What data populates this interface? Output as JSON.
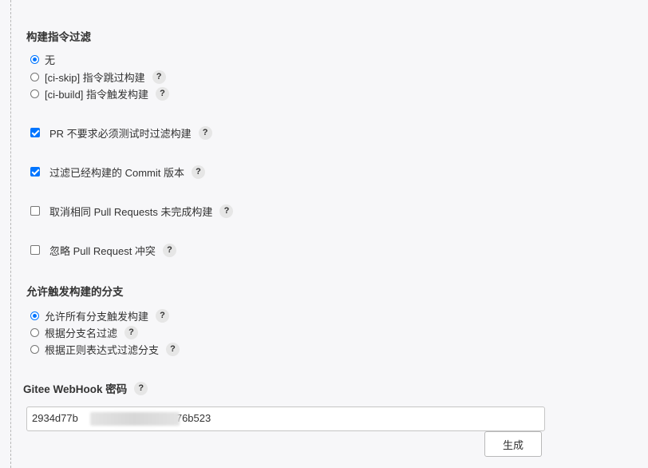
{
  "build_filter": {
    "title": "构建指令过滤",
    "options": [
      {
        "label": "无",
        "checked": true,
        "help": false
      },
      {
        "label": "[ci-skip] 指令跳过构建",
        "checked": false,
        "help": true
      },
      {
        "label": "[ci-build] 指令触发构建",
        "checked": false,
        "help": true
      }
    ]
  },
  "checkboxes": [
    {
      "label": "PR 不要求必须测试时过滤构建",
      "checked": true
    },
    {
      "label": "过滤已经构建的 Commit 版本",
      "checked": true
    },
    {
      "label": "取消相同 Pull Requests 未完成构建",
      "checked": false
    },
    {
      "label": "忽略 Pull Request 冲突",
      "checked": false
    }
  ],
  "branch_filter": {
    "title": "允许触发构建的分支",
    "options": [
      {
        "label": "允许所有分支触发构建",
        "checked": true
      },
      {
        "label": "根据分支名过滤",
        "checked": false
      },
      {
        "label": "根据正则表达式过滤分支",
        "checked": false
      }
    ]
  },
  "webhook": {
    "title": "Gitee WebHook 密码",
    "value_visible_start": "2934d77b",
    "value_visible_end": "76b523",
    "generate_label": "生成"
  },
  "help_symbol": "?",
  "colors": {
    "accent": "#0075ff",
    "background": "#f7f7f9",
    "help_badge": "#e6e6e6"
  }
}
